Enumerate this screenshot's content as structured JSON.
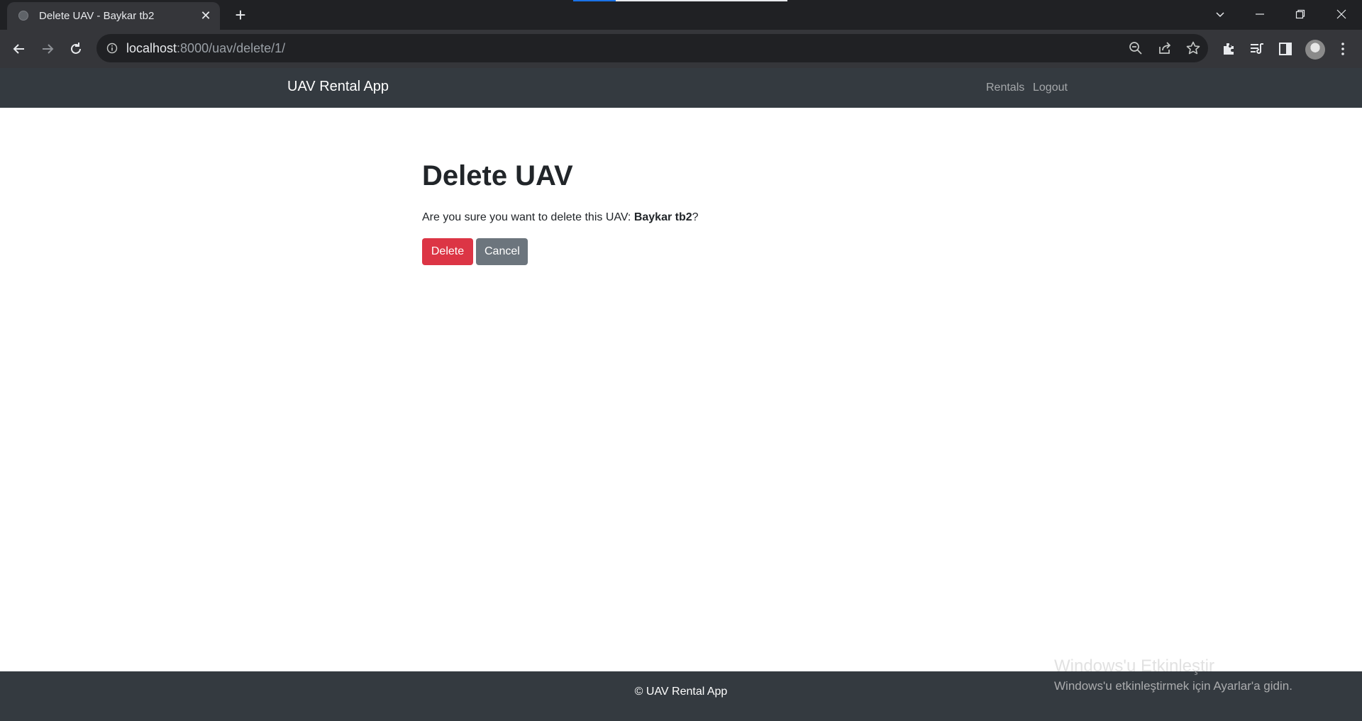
{
  "browser": {
    "tab": {
      "title": "Delete UAV - Baykar tb2",
      "close_label": "✕"
    },
    "new_tab_label": "+",
    "url": {
      "host": "localhost",
      "path": ":8000/uav/delete/1/"
    },
    "icons": [
      "back-arrow-icon",
      "forward-arrow-icon",
      "reload-icon",
      "info-icon",
      "zoom-out-icon",
      "share-icon",
      "bookmark-star-icon",
      "extensions-icon",
      "media-queue-icon",
      "side-panel-icon",
      "profile-avatar-icon",
      "more-menu-icon"
    ]
  },
  "navbar": {
    "brand": "UAV Rental App",
    "links": [
      "Rentals",
      "Logout"
    ]
  },
  "main": {
    "title": "Delete UAV",
    "confirm_prefix": "Are you sure you want to delete this UAV: ",
    "uav_name": "Baykar tb2",
    "confirm_suffix": "?",
    "delete_label": "Delete",
    "cancel_label": "Cancel"
  },
  "footer": {
    "text": "© UAV Rental App"
  },
  "overlay": {
    "activation_title": "Windows'u Etkinleştir",
    "activation_sub": "Windows'u etkinleştirmek için Ayarlar'a gidin."
  },
  "colors": {
    "navbar": "#343a40",
    "danger": "#dc3545",
    "secondary": "#6c757d"
  }
}
